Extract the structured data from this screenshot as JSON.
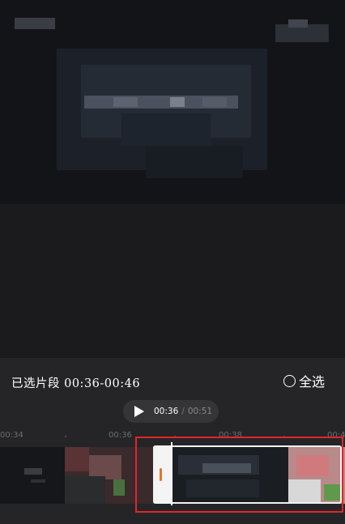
{
  "editor": {
    "selected_label": "已选片段 00:36-00:46",
    "select_all_label": "全选",
    "current_time": "00:36",
    "time_separator": "/",
    "total_time": "00:51"
  },
  "ruler": {
    "ticks": [
      "00:34",
      "00:36",
      "00:38",
      "00:4"
    ]
  },
  "colors": {
    "background": "#1b1b1d",
    "panel": "#252527",
    "handle_accent": "#e0762b",
    "annotation": "#e0262b"
  }
}
